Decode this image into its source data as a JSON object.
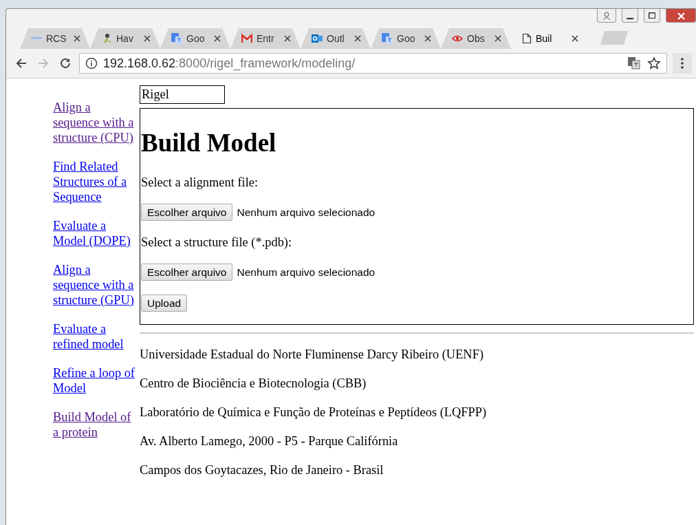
{
  "tabs": [
    {
      "label": "RCS",
      "kind": "lines",
      "selected": false
    },
    {
      "label": "Hav",
      "kind": "figure",
      "selected": false
    },
    {
      "label": "Goo",
      "kind": "translate",
      "selected": false
    },
    {
      "label": "Entr",
      "kind": "mail",
      "selected": false
    },
    {
      "label": "Outl",
      "kind": "outlook",
      "selected": false
    },
    {
      "label": "Goo",
      "kind": "translate",
      "selected": false
    },
    {
      "label": "Obs",
      "kind": "eye",
      "selected": false
    },
    {
      "label": "Buil",
      "kind": "page",
      "selected": true
    }
  ],
  "address_bar": {
    "host": "192.168.0.62",
    "path": ":8000/rigel_framework/modeling/"
  },
  "sidebar": {
    "links": [
      {
        "label": "Align a sequence with a structure (CPU)",
        "visited": true
      },
      {
        "label": "Find Related Structures of a Sequence",
        "visited": false
      },
      {
        "label": "Evaluate a Model (DOPE)",
        "visited": false
      },
      {
        "label": "Align a sequence with a structure (GPU)",
        "visited": false
      },
      {
        "label": "Evaluate a refined model",
        "visited": false
      },
      {
        "label": "Refine a loop of Model",
        "visited": false
      },
      {
        "label": "Build Model of a protein",
        "visited": true
      }
    ]
  },
  "title_field": {
    "value": "Rigel"
  },
  "form": {
    "heading": "Build Model",
    "fields": [
      {
        "label": "Select a alignment file:",
        "button": "Escolher arquivo",
        "status": "Nenhum arquivo selecionado"
      },
      {
        "label": "Select a structure file (*.pdb):",
        "button": "Escolher arquivo",
        "status": "Nenhum arquivo selecionado"
      }
    ],
    "submit": "Upload"
  },
  "footer": [
    "Universidade Estadual do Norte Fluminense Darcy Ribeiro (UENF)",
    "Centro de Biociência e Biotecnologia (CBB)",
    "Laboratório de Química e Função de Proteínas e Peptídeos (LQFPP)",
    "Av. Alberto Lamego, 2000 - P5 - Parque Califórnia",
    "Campos dos Goytacazes, Rio de Janeiro - Brasil"
  ]
}
